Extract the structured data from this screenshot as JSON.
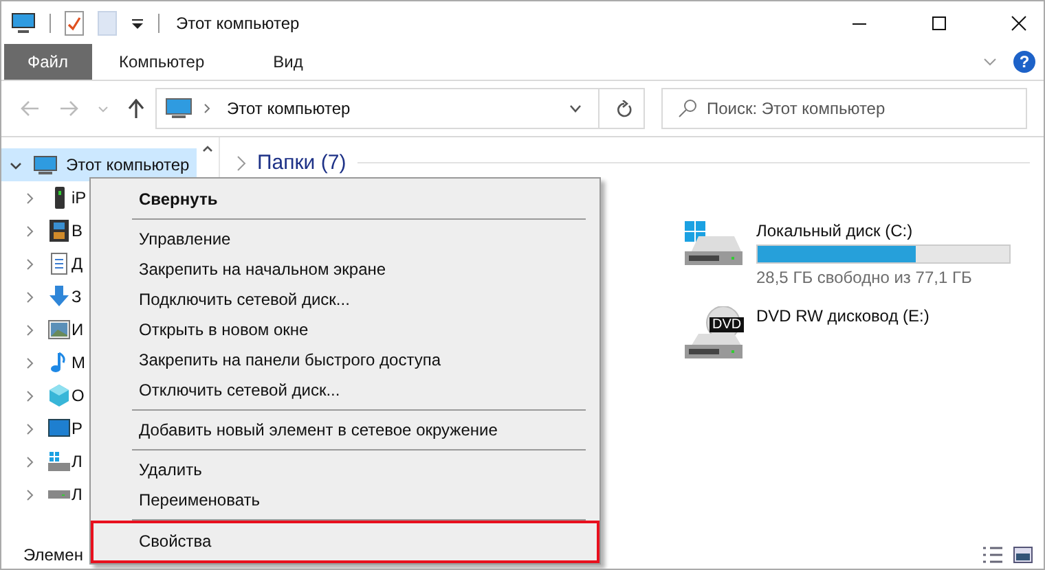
{
  "window": {
    "title": "Этот компьютер"
  },
  "ribbon": {
    "tabs": [
      {
        "label": "Файл",
        "selected": true
      },
      {
        "label": "Компьютер",
        "selected": false
      },
      {
        "label": "Вид",
        "selected": false
      }
    ],
    "help": "?"
  },
  "address_bar": {
    "path": "Этот компьютер"
  },
  "search": {
    "placeholder": "Поиск: Этот компьютер"
  },
  "sidebar": {
    "items": [
      {
        "label": "Этот компьютер",
        "selected": true,
        "expanded": true,
        "children": [
          {
            "label": "iP",
            "selected": false,
            "expanded": false
          },
          {
            "label": "В",
            "selected": false,
            "expanded": false
          },
          {
            "label": "Д",
            "selected": false,
            "expanded": false
          },
          {
            "label": "З",
            "selected": false,
            "expanded": false
          },
          {
            "label": "И",
            "selected": false,
            "expanded": false
          },
          {
            "label": "М",
            "selected": false,
            "expanded": false
          },
          {
            "label": "О",
            "selected": false,
            "expanded": false
          },
          {
            "label": "Р",
            "selected": false,
            "expanded": false
          },
          {
            "label": "Л",
            "selected": false,
            "expanded": false
          },
          {
            "label": "Л",
            "selected": false,
            "expanded": false
          }
        ]
      }
    ]
  },
  "content": {
    "groups": [
      {
        "title": "Папки (7)",
        "expanded": false
      }
    ],
    "drives": [
      {
        "kind": "disk",
        "name": "Локальный диск (C:)",
        "level": 0.63,
        "free": "28,5 ГБ свободно из 77,1 ГБ"
      },
      {
        "kind": "optical",
        "name": "DVD RW дисковод (E:)",
        "badge": "DVD"
      }
    ]
  },
  "context_menu": {
    "items": [
      {
        "kind": "default",
        "label": "Свернуть",
        "highlighted": false
      },
      {
        "kind": "separator"
      },
      {
        "kind": "item",
        "label": "Управление",
        "highlighted": false
      },
      {
        "kind": "item",
        "label": "Закрепить на начальном экране",
        "highlighted": false
      },
      {
        "kind": "item",
        "label": "Подключить сетевой диск...",
        "highlighted": false
      },
      {
        "kind": "item",
        "label": "Открыть в новом окне",
        "highlighted": false
      },
      {
        "kind": "item",
        "label": "Закрепить на панели быстрого доступа",
        "highlighted": false
      },
      {
        "kind": "item",
        "label": "Отключить сетевой диск...",
        "highlighted": false
      },
      {
        "kind": "separator"
      },
      {
        "kind": "item",
        "label": "Добавить новый элемент в сетевое окружение",
        "highlighted": false
      },
      {
        "kind": "separator"
      },
      {
        "kind": "item",
        "label": "Удалить",
        "highlighted": false
      },
      {
        "kind": "item",
        "label": "Переименовать",
        "highlighted": false
      },
      {
        "kind": "separator"
      },
      {
        "kind": "item",
        "label": "Свойства",
        "highlighted": true
      }
    ]
  },
  "status_bar": {
    "text": "Элемен"
  }
}
